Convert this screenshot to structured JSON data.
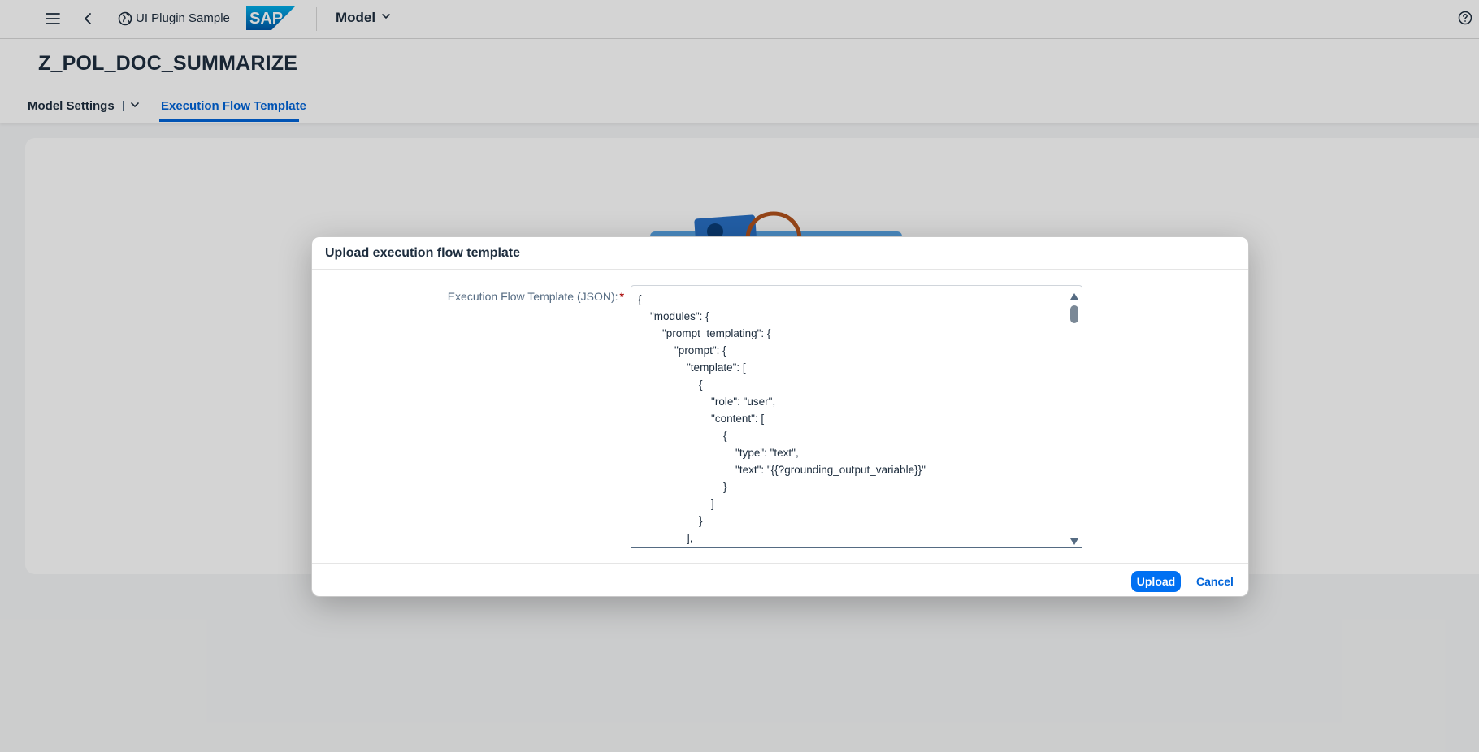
{
  "shell": {
    "app_title": "UI Plugin Sample",
    "logo_text": "SAP",
    "model_menu": "Model"
  },
  "header": {
    "title": "Z_POL_DOC_SUMMARIZE",
    "tabs": [
      {
        "label": "Model Settings",
        "selected": false
      },
      {
        "label": "Execution Flow Template",
        "selected": true
      }
    ]
  },
  "dialog": {
    "title": "Upload execution flow template",
    "field_label": "Execution Flow Template (JSON):",
    "required_mark": "*",
    "json_value": "{\n\t\"modules\": {\n\t\t\"prompt_templating\": {\n\t\t\t\"prompt\": {\n\t\t\t\t\"template\": [\n\t\t\t\t\t{\n\t\t\t\t\t\t\"role\": \"user\",\n\t\t\t\t\t\t\"content\": [\n\t\t\t\t\t\t\t{\n\t\t\t\t\t\t\t\t\"type\": \"text\",\n\t\t\t\t\t\t\t\t\"text\": \"{{?grounding_output_variable}}\"\n\t\t\t\t\t\t\t}\n\t\t\t\t\t\t]\n\t\t\t\t\t}\n\t\t\t\t],",
    "upload_label": "Upload",
    "cancel_label": "Cancel"
  },
  "colors": {
    "accent": "#0070f2",
    "link": "#0064d9",
    "required": "#aa0808"
  }
}
